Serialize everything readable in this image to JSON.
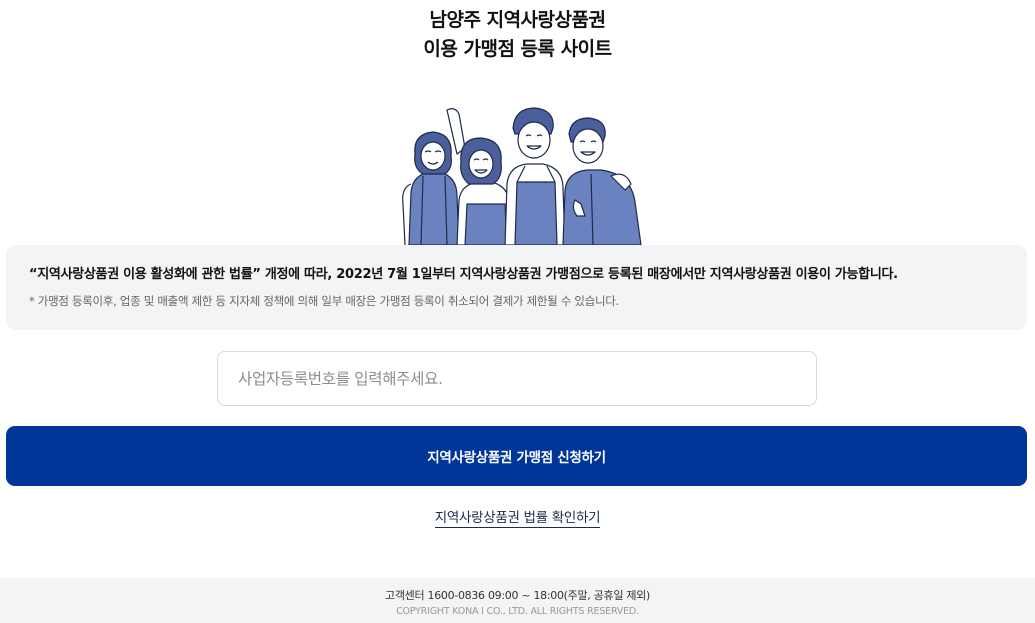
{
  "header": {
    "title_line1": "남양주 지역사랑상품권",
    "title_line2": "이용 가맹점 등록 사이트"
  },
  "illustration": {
    "icon": "people-cheering-illustration",
    "accent_color": "#6b82c0"
  },
  "notice": {
    "main": "“지역사랑상품권 이용 활성화에 관한 법률” 개정에 따라, 2022년 7월 1일부터 지역사랑상품권 가맹점으로 등록된 매장에서만 지역사랑상품권 이용이 가능합니다.",
    "sub": "* 가맹점 등록이후, 업종 및 매출액 제한 등 지자체 정책에 의해 일부 매장은 가맹점 등록이 취소되어 결제가 제한될 수 있습니다."
  },
  "search": {
    "placeholder": "사업자등록번호를 입력해주세요.",
    "value": ""
  },
  "apply_button": {
    "label": "지역사랑상품권 가맹점 신청하기",
    "color": "#00359a"
  },
  "law_link": {
    "label": "지역사랑상품권 법률 확인하기"
  },
  "footer": {
    "contact": "고객센터 1600-0836 09:00 ~ 18:00(주말, 공휴일 제외)",
    "copyright": "COPYRIGHT KONA I CO., LTD. ALL RIGHTS RESERVED."
  }
}
